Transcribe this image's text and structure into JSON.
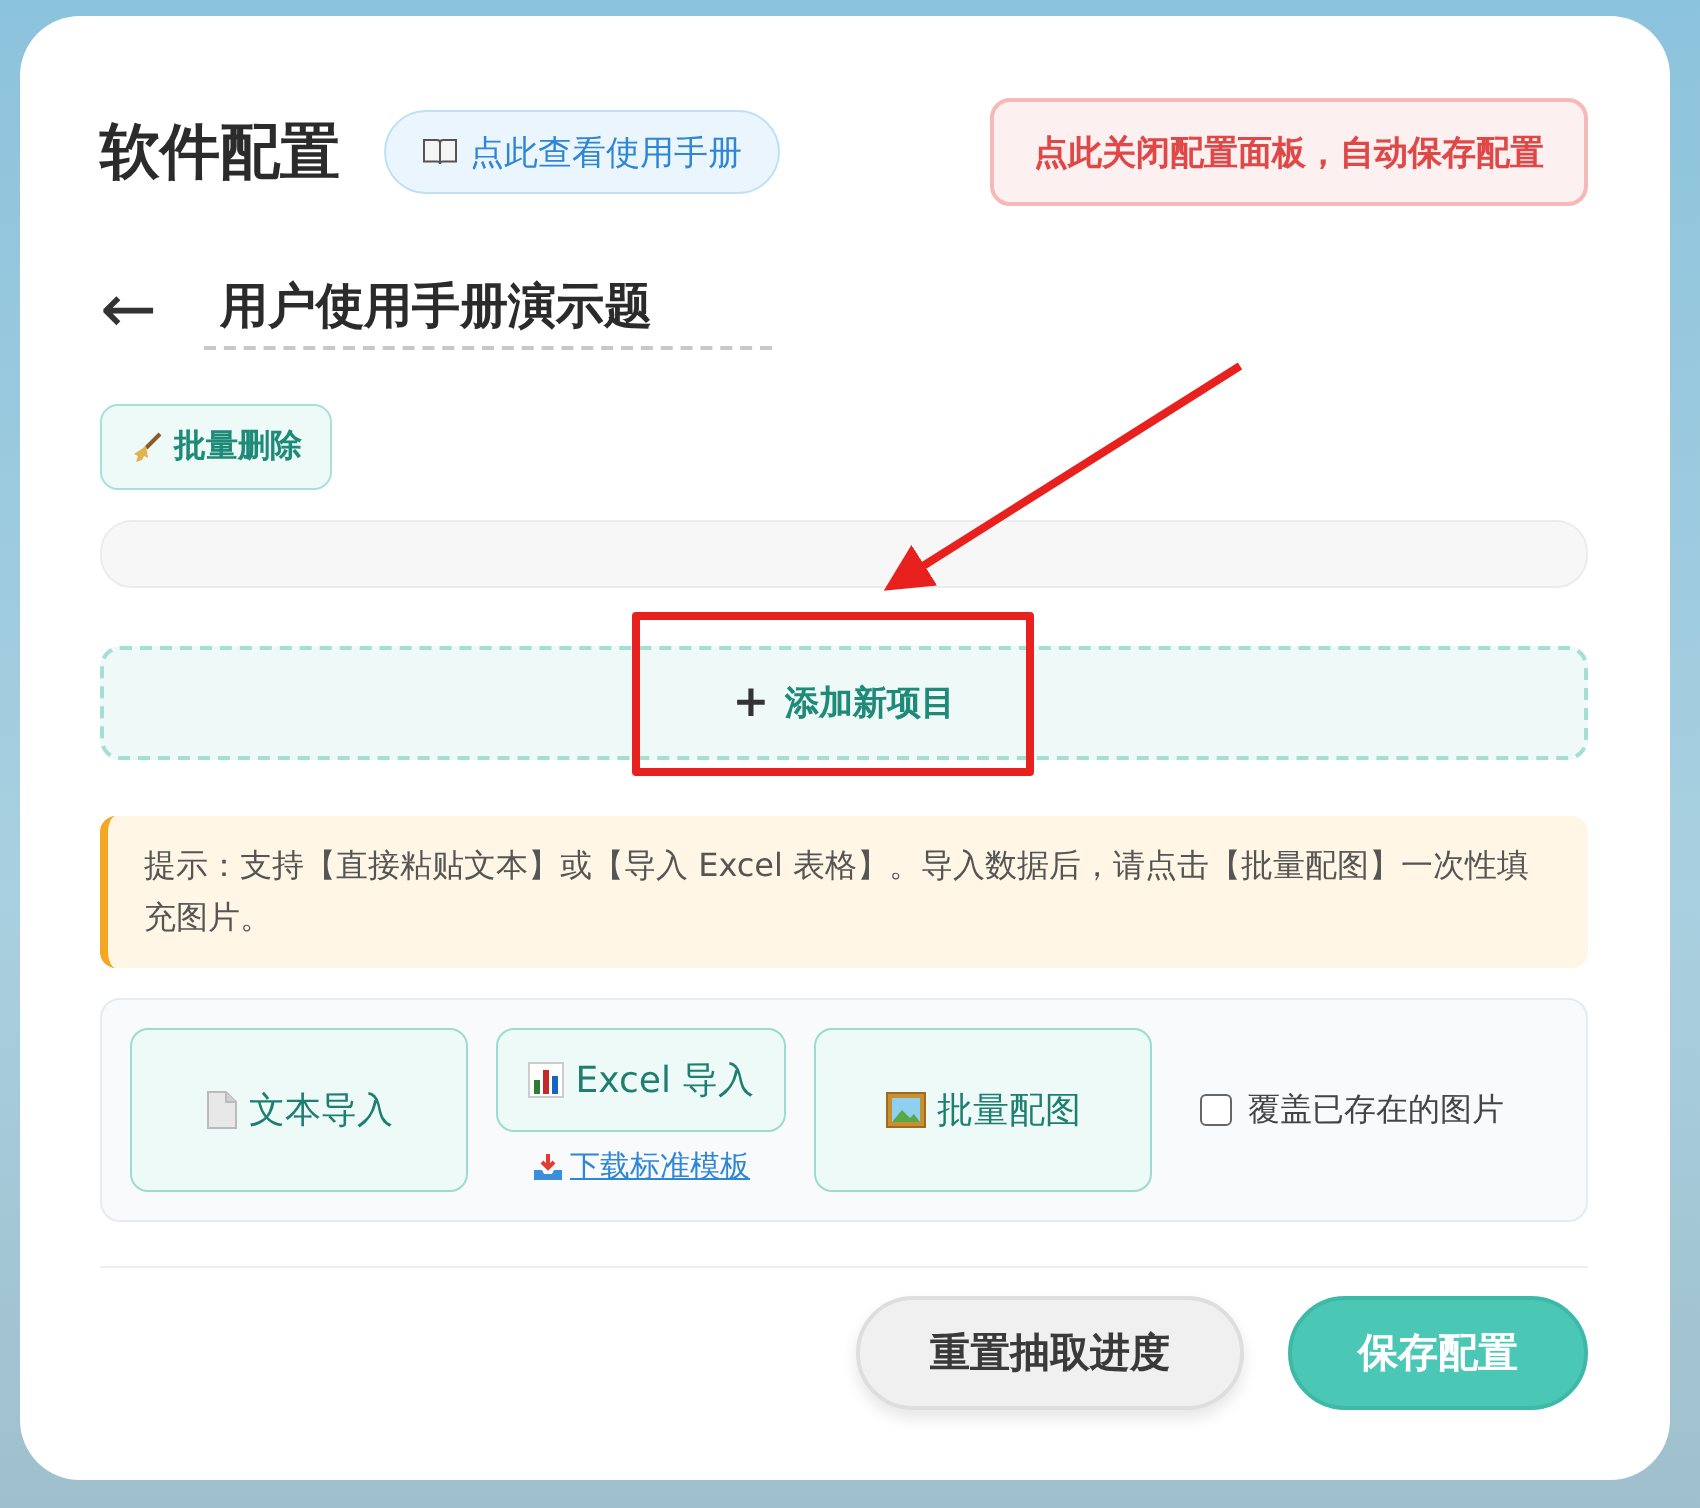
{
  "title": "软件配置",
  "manual_button": "点此查看使用手册",
  "close_button": "点此关闭配置面板，自动保存配置",
  "back_button": "←",
  "name_field": {
    "value": "用户使用手册演示题"
  },
  "batch_delete_button": "批量删除",
  "add_item_button": {
    "plus": "+",
    "label": "添加新项目"
  },
  "hint": "提示：支持【直接粘贴文本】或【导入 Excel 表格】。导入数据后，请点击【批量配图】一次性填充图片。",
  "import_buttons": [
    {
      "kind": "text",
      "label": "文本导入"
    },
    {
      "kind": "excel",
      "label": "Excel 导入",
      "link": "下载标准模板"
    },
    {
      "kind": "image",
      "label": "批量配图"
    }
  ],
  "overwrite_checkbox": {
    "label": "覆盖已存在的图片",
    "checked": false
  },
  "footer_buttons": [
    {
      "kind": "secondary",
      "label": "重置抽取进度"
    },
    {
      "kind": "primary",
      "label": "保存配置"
    }
  ]
}
